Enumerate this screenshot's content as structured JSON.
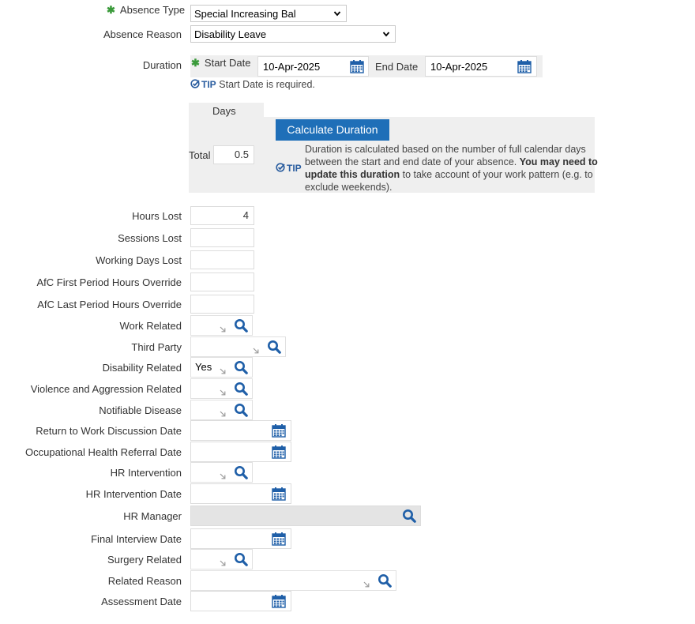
{
  "absence_type": {
    "label": "Absence Type",
    "value": "Special Increasing Bal",
    "required": "✱"
  },
  "absence_reason": {
    "label": "Absence Reason",
    "value": "Disability Leave"
  },
  "duration": {
    "label": "Duration",
    "start_label": "Start Date",
    "start_value": "10-Apr-2025",
    "end_label": "End Date",
    "end_value": "10-Apr-2025",
    "required": "✱",
    "tip_label": "TIP",
    "tip_text": "Start Date is required."
  },
  "days": {
    "header": "Days",
    "total_label": "Total",
    "total_value": "0.5",
    "calc_button": "Calculate Duration",
    "tip_label": "TIP",
    "tip_part1": "Duration is calculated based on the number of full calendar days between the start and end date of your absence. ",
    "tip_bold": "You may need to update this duration",
    "tip_part2": " to take account of your work pattern (e.g. to exclude weekends)."
  },
  "fields": {
    "hours_lost": {
      "label": "Hours Lost",
      "value": "4"
    },
    "sessions_lost": {
      "label": "Sessions Lost",
      "value": ""
    },
    "working_days_lost": {
      "label": "Working Days Lost",
      "value": ""
    },
    "afc_first": {
      "label": "AfC First Period Hours Override",
      "value": ""
    },
    "afc_last": {
      "label": "AfC Last Period Hours Override",
      "value": ""
    },
    "work_related": {
      "label": "Work Related",
      "value": ""
    },
    "third_party": {
      "label": "Third Party",
      "value": ""
    },
    "disability_related": {
      "label": "Disability Related",
      "value": "Yes"
    },
    "violence_related": {
      "label": "Violence and Aggression Related",
      "value": ""
    },
    "notifiable_disease": {
      "label": "Notifiable Disease",
      "value": ""
    },
    "rtw_date": {
      "label": "Return to Work Discussion Date",
      "value": ""
    },
    "oh_referral_date": {
      "label": "Occupational Health Referral Date",
      "value": ""
    },
    "hr_intervention": {
      "label": "HR Intervention",
      "value": ""
    },
    "hr_intervention_date": {
      "label": "HR Intervention Date",
      "value": ""
    },
    "hr_manager": {
      "label": "HR Manager",
      "value": ""
    },
    "final_interview_date": {
      "label": "Final Interview Date",
      "value": ""
    },
    "surgery_related": {
      "label": "Surgery Related",
      "value": ""
    },
    "related_reason": {
      "label": "Related Reason",
      "value": ""
    },
    "assessment_date": {
      "label": "Assessment Date",
      "value": ""
    }
  },
  "icons": {
    "search": "search-icon",
    "calendar": "calendar-icon",
    "arrow": "list-arrow-icon",
    "tip": "check-tip-icon"
  },
  "colors": {
    "accent": "#1f6fb8",
    "required": "#3a9a3a",
    "panel": "#efefef",
    "icon": "#2a5d9f"
  }
}
